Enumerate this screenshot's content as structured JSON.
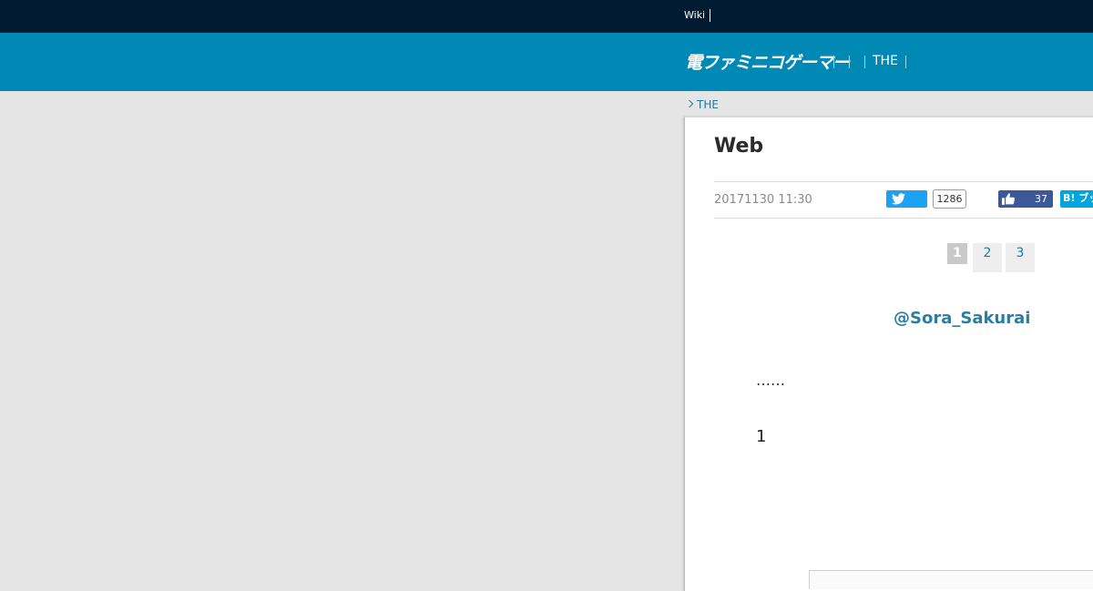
{
  "topbar": {
    "wiki_label": "Wiki"
  },
  "header": {
    "logo_text": "電ファミニコゲーマー",
    "nav": [
      {
        "label": ""
      },
      {
        "label": ""
      },
      {
        "label": "THE"
      }
    ]
  },
  "breadcrumb": {
    "label": "THE"
  },
  "article": {
    "title": "Web",
    "date": "20171130 11:30",
    "tweet_count": "1286",
    "like_count": "37",
    "hatena_label": "B! ブックマーク",
    "pagination": [
      "1",
      "2",
      "3"
    ],
    "current_page": "1",
    "twitter_handle": "@Sora_Sakurai",
    "paragraphs": [
      "……",
      "1"
    ]
  },
  "colors": {
    "topbar": "#001b32",
    "header": "#0089b5",
    "twitter": "#1da1f2",
    "facebook": "#3b5998",
    "hatena": "#00a4de",
    "link": "#1a7aa8"
  }
}
